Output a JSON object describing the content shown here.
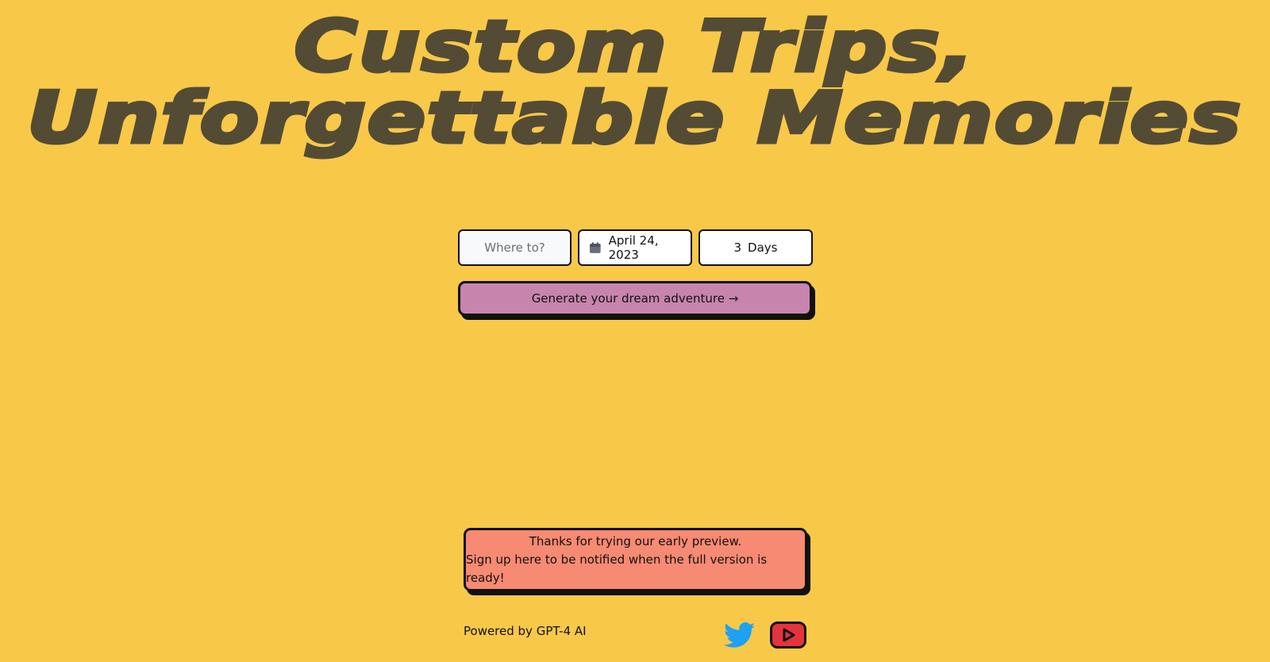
{
  "hero": {
    "line1": "Custom Trips,",
    "line2": "Unforgettable Memories"
  },
  "form": {
    "destination_placeholder": "Where to?",
    "date_value": "April 24, 2023",
    "days_count": "3",
    "days_unit": "Days"
  },
  "generate_button": {
    "label": "Generate your dream adventure →"
  },
  "notice": {
    "line1": "Thanks for trying our early preview.",
    "line2": "Sign up here to be notified when the full version is ready!"
  },
  "footer": {
    "powered_by": "Powered by GPT-4 AI",
    "social_icons": [
      "twitter-icon",
      "youtube-icon"
    ]
  },
  "colors": {
    "background": "#f8c849",
    "hero_text": "#534b34",
    "button": "#c785ae",
    "notice": "#f78a72",
    "twitter": "#1da1f2",
    "youtube": "#e5333d"
  }
}
